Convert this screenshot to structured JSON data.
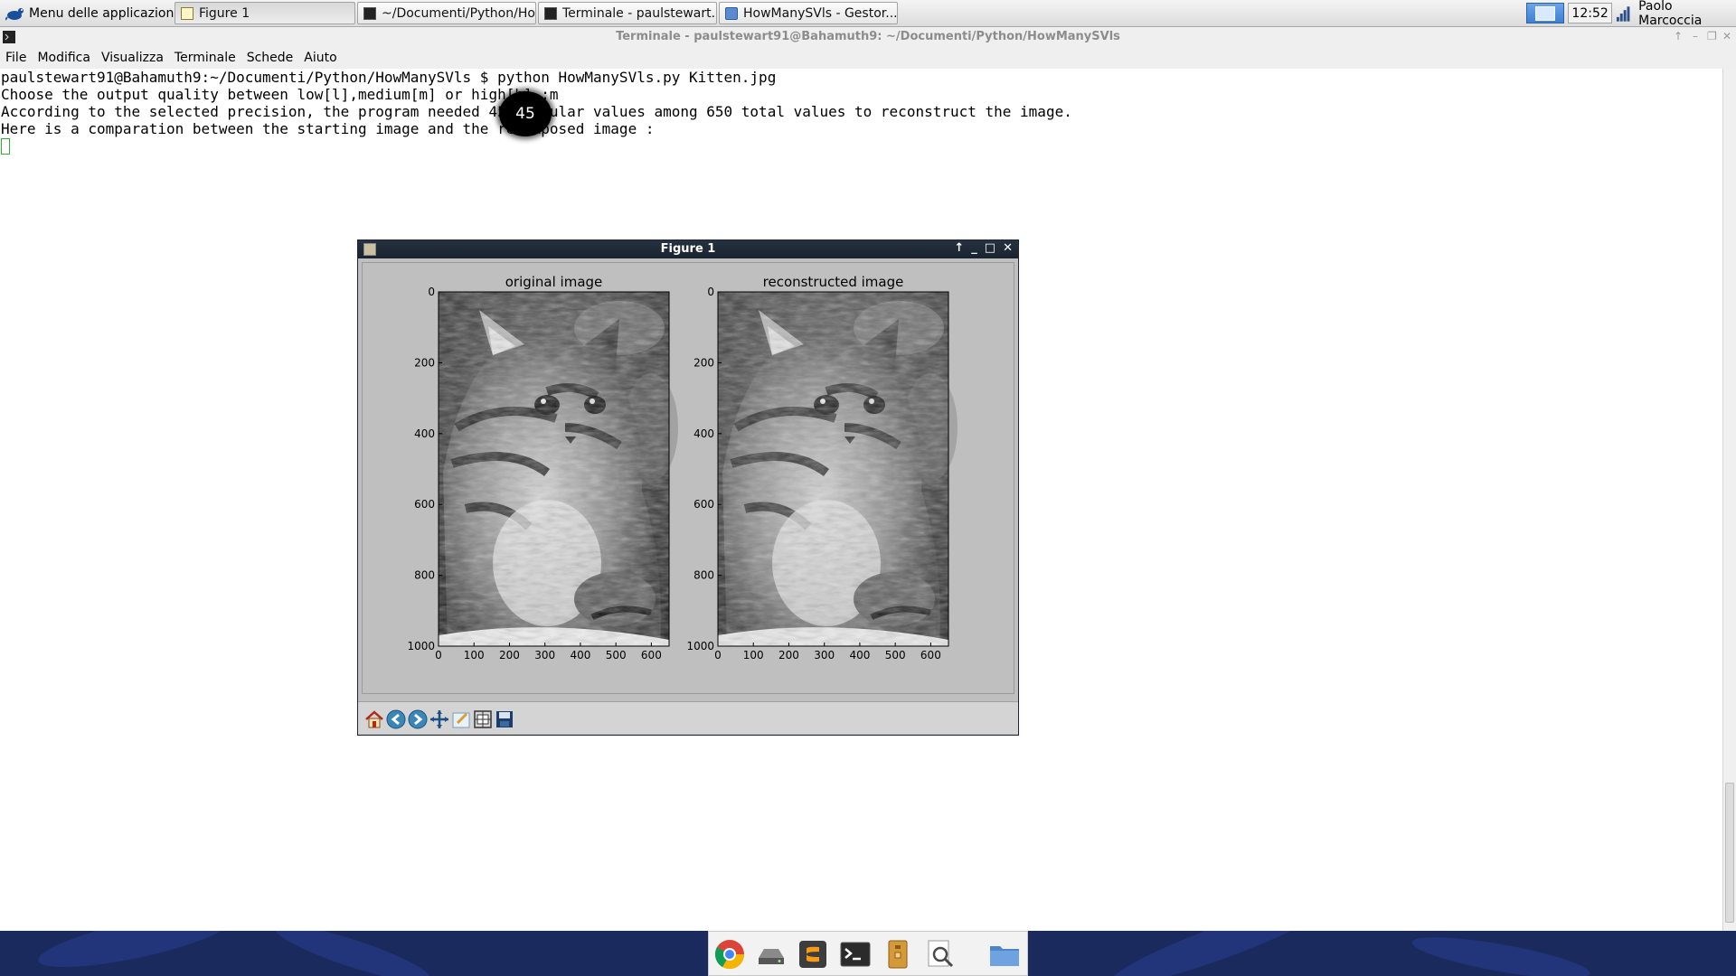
{
  "panel": {
    "app_menu_label": "Menu delle applicazioni",
    "tasks": [
      {
        "label": "Figure 1",
        "icon": "figure-icon"
      },
      {
        "label": "~/Documenti/Python/Ho...",
        "icon": "terminal-icon"
      },
      {
        "label": "Terminale - paulstewart...",
        "icon": "terminal-icon"
      },
      {
        "label": "HowManySVls  - Gestor...",
        "icon": "folder-icon"
      }
    ],
    "clock": "12:52",
    "user": "Paolo Marcoccia"
  },
  "terminal": {
    "title": "Terminale - paulstewart91@Bahamuth9: ~/Documenti/Python/HowManySVls",
    "menu": [
      "File",
      "Modifica",
      "Visualizza",
      "Terminale",
      "Schede",
      "Aiuto"
    ],
    "lines": [
      "paulstewart91@Bahamuth9:~/Documenti/Python/HowManySVls $ python HowManySVls.py Kitten.jpg",
      "Choose the output quality between low[l],medium[m] or high[h] :m",
      "According to the selected precision, the program needed 45 singular values among 650 total values to reconstruct the image.",
      "Here is a comparation between the starting image and the recomposed image :"
    ],
    "highlight_value": "45"
  },
  "figure": {
    "title": "Figure 1",
    "subplots": [
      {
        "title": "original image",
        "yticks": [
          "0",
          "200",
          "400",
          "600",
          "800",
          "1000"
        ],
        "xticks": [
          "0",
          "100",
          "200",
          "300",
          "400",
          "500",
          "600"
        ]
      },
      {
        "title": "reconstructed image",
        "yticks": [
          "0",
          "200",
          "400",
          "600",
          "800",
          "1000"
        ],
        "xticks": [
          "0",
          "100",
          "200",
          "300",
          "400",
          "500",
          "600"
        ]
      }
    ],
    "toolbar": [
      "home-icon",
      "back-icon",
      "forward-icon",
      "pan-icon",
      "zoom-icon",
      "subplots-icon",
      "save-icon"
    ]
  },
  "dock": [
    "chrome-icon",
    "drive-icon",
    "sublime-icon",
    "terminal-icon",
    "archive-icon",
    "search-icon",
    "folder-icon"
  ],
  "colors": {
    "panel_accent": "#3f7fd0",
    "fig_titlebar": "#1a2330",
    "dock_bg": "#1a2a5c"
  }
}
